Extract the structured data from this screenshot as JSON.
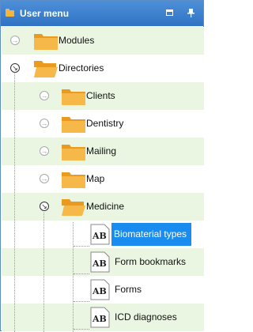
{
  "header": {
    "title": "User menu"
  },
  "tree": {
    "modules": "Modules",
    "directories": "Directories",
    "clients": "Clients",
    "dentistry": "Dentistry",
    "mailing": "Mailing",
    "map": "Map",
    "medicine": "Medicine",
    "biomaterial_types": "Biomaterial types",
    "form_bookmarks": "Form bookmarks",
    "forms": "Forms",
    "icd_diagnoses": "ICD diagnoses"
  },
  "icon_text": "AB",
  "colors": {
    "header": "#2f73c3",
    "selection": "#1a8cf0",
    "row_alt": "#eaf6e2",
    "folder": "#f5b43a"
  }
}
